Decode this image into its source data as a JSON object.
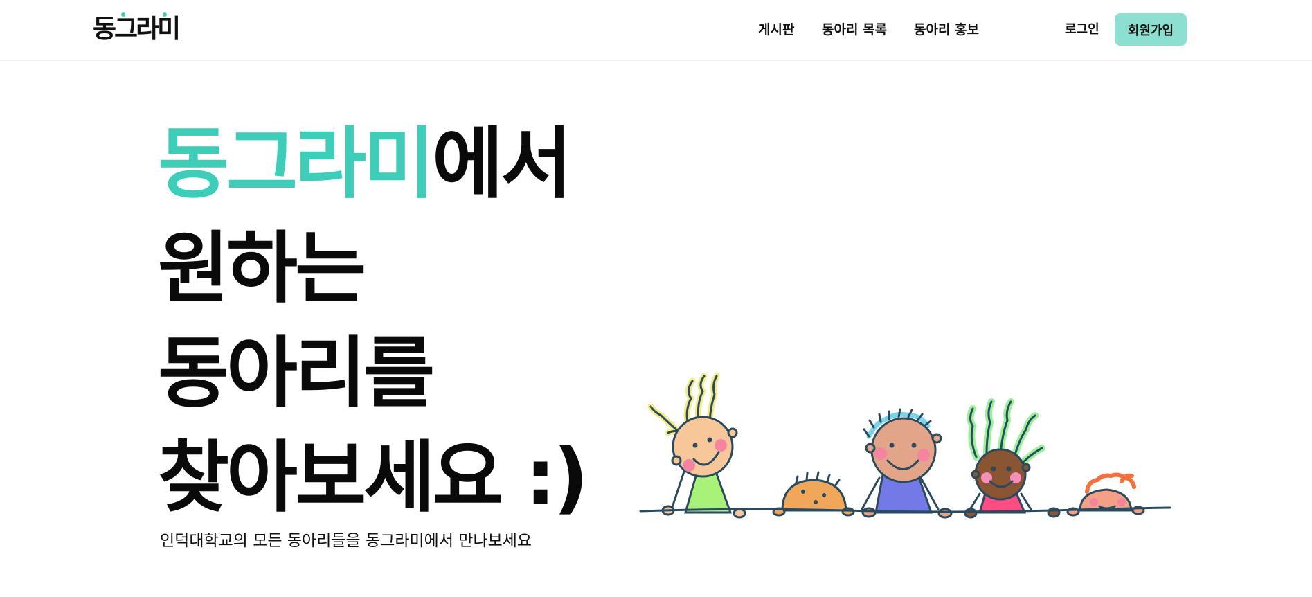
{
  "header": {
    "logo": "동그라미",
    "nav": [
      "게시판",
      "동아리 목록",
      "동아리 홍보"
    ],
    "login": "로그인",
    "signup": "회원가입"
  },
  "hero": {
    "line1_accent": "동그라미",
    "line1_rest": "에서",
    "line2": "원하는",
    "line3": "동아리를",
    "line4": "찾아보세요 :)",
    "subtitle": "인덕대학교의 모든 동아리들을 동그라미에서 만나보세요"
  },
  "colors": {
    "accent": "#3ecdb8",
    "signup_bg": "#8ce0d1",
    "text": "#0a0a0a"
  },
  "illustration": {
    "kids": [
      "yellow-hair-kid",
      "bald-kid",
      "blue-hair-kid",
      "green-hair-kid",
      "red-hair-kid"
    ]
  }
}
